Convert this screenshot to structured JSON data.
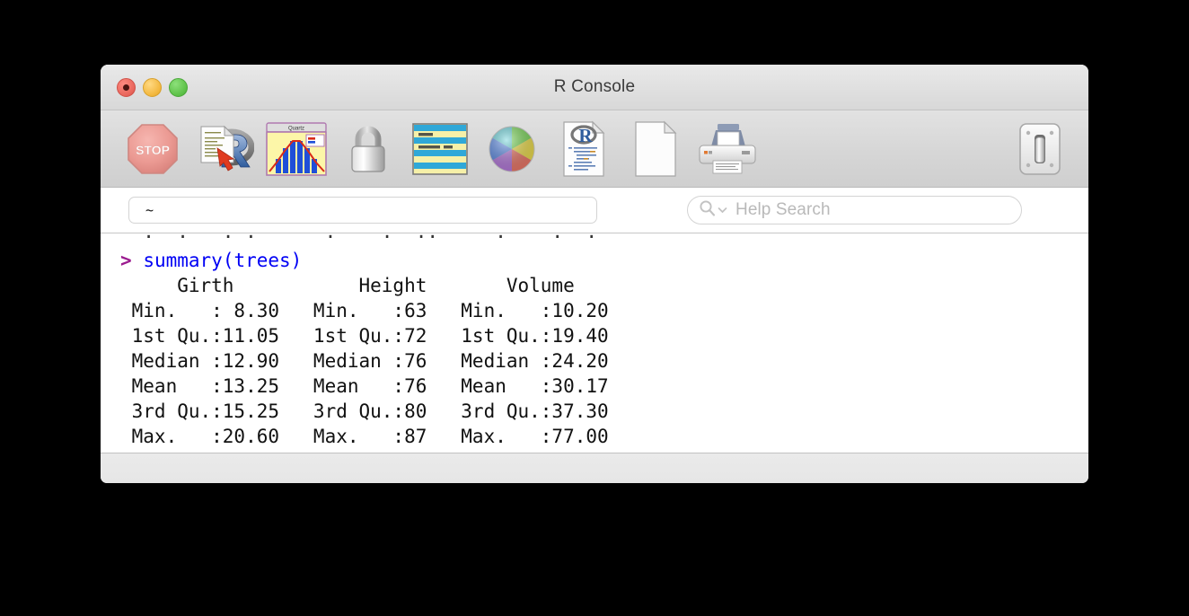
{
  "window": {
    "title": "R Console",
    "controls": {
      "close_label": "close",
      "minimize_label": "minimize",
      "zoom_label": "zoom"
    }
  },
  "toolbar": {
    "buttons": [
      {
        "name": "stop-button",
        "icon": "stop-icon",
        "label": "Stop"
      },
      {
        "name": "source-file-button",
        "icon": "source-r-file-icon",
        "label": "Source File"
      },
      {
        "name": "quartz-button",
        "icon": "quartz-plot-icon",
        "label": "Quartz"
      },
      {
        "name": "lock-button",
        "icon": "lock-icon",
        "label": "Lock"
      },
      {
        "name": "workspace-button",
        "icon": "workspace-browser-icon",
        "label": "Workspace Browser"
      },
      {
        "name": "colors-button",
        "icon": "color-wheel-icon",
        "label": "Colors"
      },
      {
        "name": "r-document-button",
        "icon": "r-document-icon",
        "label": "R Document"
      },
      {
        "name": "new-document-button",
        "icon": "blank-document-icon",
        "label": "New Document"
      },
      {
        "name": "print-button",
        "icon": "printer-icon",
        "label": "Print"
      }
    ],
    "toggle": {
      "name": "toolbar-toggle-button",
      "icon": "light-switch-icon",
      "label": "Toggle"
    }
  },
  "pathbar": {
    "value": "~",
    "placeholder": "~"
  },
  "search": {
    "placeholder": "Help Search",
    "icon": "search-icon",
    "chevron": "chevron-down-icon"
  },
  "console": {
    "clipped_top_line": "  .  .   . .      .    .  ..     .    .  .",
    "prompt": ">",
    "command": "summary(trees)",
    "output_header": "     Girth           Height       Volume    ",
    "output_lines": [
      " Min.   : 8.30   Min.   :63   Min.   :10.20  ",
      " 1st Qu.:11.05   1st Qu.:72   1st Qu.:19.40  ",
      " Median :12.90   Median :76   Median :24.20  ",
      " Mean   :13.25   Mean   :76   Mean   :30.17  ",
      " 3rd Qu.:15.25   3rd Qu.:80   3rd Qu.:37.30  ",
      " Max.   :20.60   Max.   :87   Max.   :77.00  "
    ]
  },
  "summary_table": {
    "columns": [
      "Girth",
      "Height",
      "Volume"
    ],
    "stats": [
      "Min.",
      "1st Qu.",
      "Median",
      "Mean",
      "3rd Qu.",
      "Max."
    ],
    "Girth": [
      "8.30",
      "11.05",
      "12.90",
      "13.25",
      "15.25",
      "20.60"
    ],
    "Height": [
      "63",
      "72",
      "76",
      "76",
      "80",
      "87"
    ],
    "Volume": [
      "10.20",
      "19.40",
      "24.20",
      "30.17",
      "37.30",
      "77.00"
    ]
  },
  "colors": {
    "prompt": "#9b1b8f",
    "command": "#0000f5",
    "output": "#111111",
    "toolbar_bg": "#d8d8d8",
    "titlebar_bg": "#e3e3e3",
    "console_bg": "#ffffff",
    "desktop_bg": "#000000"
  }
}
